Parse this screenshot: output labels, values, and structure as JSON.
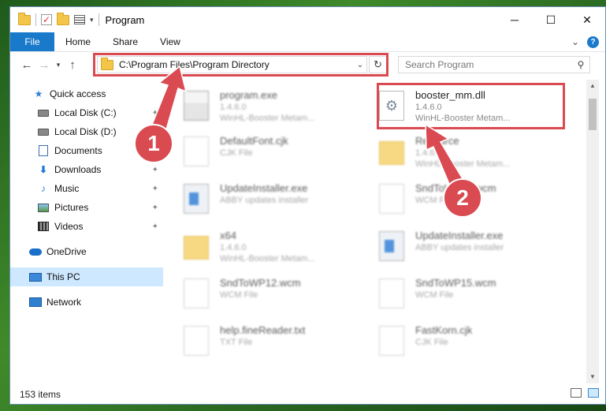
{
  "window": {
    "title": "Program",
    "controls": {
      "minimize": "─",
      "maximize": "☐",
      "close": "✕"
    }
  },
  "ribbon": {
    "tabs": [
      "File",
      "Home",
      "Share",
      "View"
    ]
  },
  "address_bar": {
    "path": "C:\\Program Files\\Program Directory"
  },
  "search": {
    "placeholder": "Search Program"
  },
  "sidebar": {
    "items": [
      {
        "label": "Quick access",
        "icon": "star-icon"
      },
      {
        "label": "Local Disk (C:)",
        "icon": "drive-icon"
      },
      {
        "label": "Local Disk (D:)",
        "icon": "drive-icon"
      },
      {
        "label": "Documents",
        "icon": "documents-icon"
      },
      {
        "label": "Downloads",
        "icon": "downloads-icon"
      },
      {
        "label": "Music",
        "icon": "music-icon"
      },
      {
        "label": "Pictures",
        "icon": "pictures-icon"
      },
      {
        "label": "Videos",
        "icon": "videos-icon"
      },
      {
        "label": "OneDrive",
        "icon": "cloud-icon"
      },
      {
        "label": "This PC",
        "icon": "computer-icon",
        "selected": true
      },
      {
        "label": "Network",
        "icon": "network-icon"
      }
    ]
  },
  "files": [
    {
      "name": "program.exe",
      "line1": "1.4.6.0",
      "line2": "WinHL-Booster Metam...",
      "type": "exe"
    },
    {
      "name": "booster_mm.dll",
      "line1": "1.4.6.0",
      "line2": "WinHL-Booster Metam...",
      "type": "dll",
      "highlighted": true
    },
    {
      "name": "DefaultFont.cjk",
      "line1": "CJK File",
      "line2": "",
      "type": "file"
    },
    {
      "name": "Resource",
      "line1": "1.4.6.0",
      "line2": "WinHL-Booster Metam...",
      "type": "folder"
    },
    {
      "name": "UpdateInstaller.exe",
      "line1": "ABBY updates installer",
      "line2": "",
      "type": "exe2"
    },
    {
      "name": "SndToWP15.wcm",
      "line1": "WCM File",
      "line2": "",
      "type": "file"
    },
    {
      "name": "x64",
      "line1": "1.4.6.0",
      "line2": "WinHL-Booster Metam...",
      "type": "folder"
    },
    {
      "name": "UpdateInstaller.exe",
      "line1": "ABBY updates installer",
      "line2": "",
      "type": "exe2"
    },
    {
      "name": "SndToWP12.wcm",
      "line1": "WCM File",
      "line2": "",
      "type": "file"
    },
    {
      "name": "SndToWP15.wcm",
      "line1": "WCM File",
      "line2": "",
      "type": "file"
    },
    {
      "name": "help.fineReader.txt",
      "line1": "TXT File",
      "line2": "",
      "type": "file"
    },
    {
      "name": "FastKorn.cjk",
      "line1": "CJK File",
      "line2": "",
      "type": "file"
    }
  ],
  "status": {
    "count": "153 items"
  },
  "annotations": {
    "step1": "1",
    "step2": "2",
    "color": "#d94a51"
  }
}
